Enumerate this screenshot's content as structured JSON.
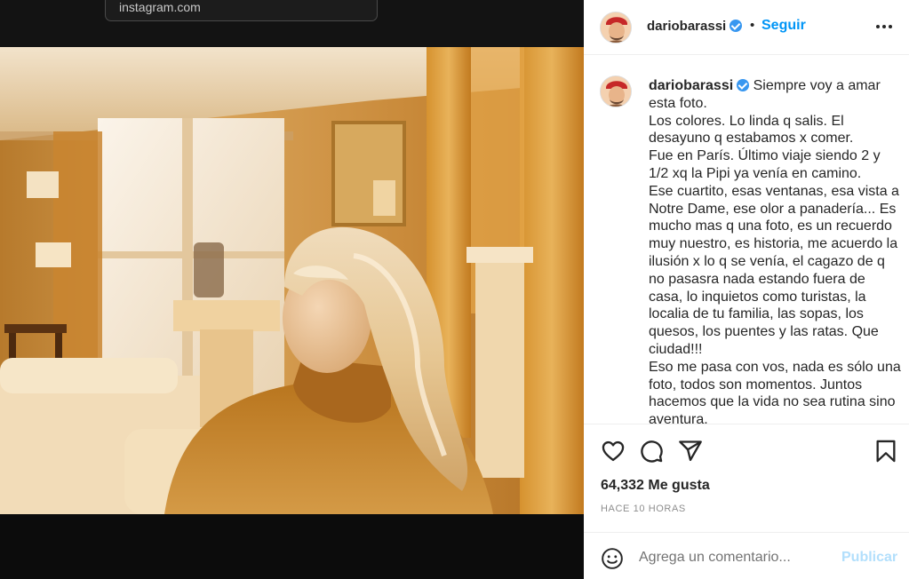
{
  "browser": {
    "url": "instagram.com"
  },
  "post": {
    "username": "dariobarassi",
    "follow_label": "Seguir",
    "separator": "•",
    "caption": "Siempre voy a amar esta foto.\nLos colores. Lo linda q salis. El desayuno q estabamos x comer.\nFue en París. Último viaje siendo 2 y 1/2 xq la Pipi ya venía en camino.\nEse cuartito, esas ventanas, esa vista a Notre Dame, ese olor a panadería... Es mucho mas q una foto, es un recuerdo muy nuestro, es historia, me acuerdo la ilusión x lo q se venía, el cagazo de q no pasasra nada estando fuera de casa, lo inquietos como turistas, la localia de tu familia, las sopas, los quesos, los puentes y las ratas. Que ciudad!!!\nEso me pasa con vos, nada es sólo una foto, todos son momentos. Juntos hacemos que la vida no sea rutina sino aventura.",
    "likes": "64,332 Me gusta",
    "time": "HACE 10 HORAS"
  },
  "comment": {
    "placeholder": "Agrega un comentario...",
    "publish_label": "Publicar"
  },
  "icons": {
    "verified": "verified-badge-icon",
    "more": "more-options-icon",
    "like": "heart-icon",
    "comment": "comment-bubble-icon",
    "share": "paper-plane-icon",
    "save": "bookmark-icon",
    "emoji": "smiley-icon"
  },
  "colors": {
    "link": "#0095f6",
    "verified": "#3897f0",
    "publish_disabled": "#b2dffc",
    "muted": "#8e8e8e"
  }
}
